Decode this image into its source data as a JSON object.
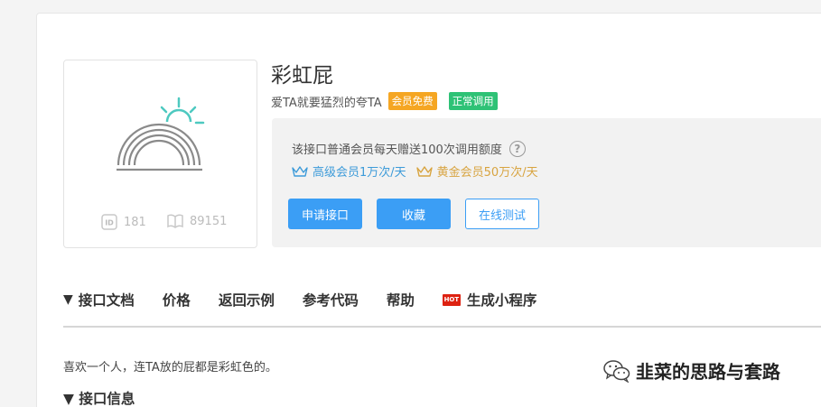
{
  "api": {
    "title": "彩虹屁",
    "subtitle": "爱TA就要猛烈的夸TA",
    "badges": [
      "会员免费",
      "正常调用"
    ],
    "id": "181",
    "views": "89151"
  },
  "panel": {
    "quota_text": "该接口普通会员每天赠送100次调用额度",
    "tier_advanced": "高级会员1万次/天",
    "tier_gold": "黄金会员50万次/天",
    "buttons": {
      "apply": "申请接口",
      "favorite": "收藏",
      "test": "在线测试"
    }
  },
  "tabs": [
    {
      "label": "接口文档",
      "caret": "▼"
    },
    {
      "label": "价格"
    },
    {
      "label": "返回示例"
    },
    {
      "label": "参考代码"
    },
    {
      "label": "帮助"
    },
    {
      "label": "生成小程序",
      "badge": "HOT"
    }
  ],
  "content": {
    "description": "喜欢一个人，连TA放的屁都是彩虹色的。",
    "section_title": "接口信息",
    "section_caret": "▼"
  },
  "watermark": {
    "text": "韭菜的思路与套路",
    "icon": "wechat-icon"
  },
  "colors": {
    "primary": "#3b9ef5",
    "badge_orange": "#f5a623",
    "badge_green": "#2ec276",
    "tier_blue": "#3d9bd9",
    "tier_gold": "#d8a440",
    "logo_teal": "#4ec9c0"
  }
}
